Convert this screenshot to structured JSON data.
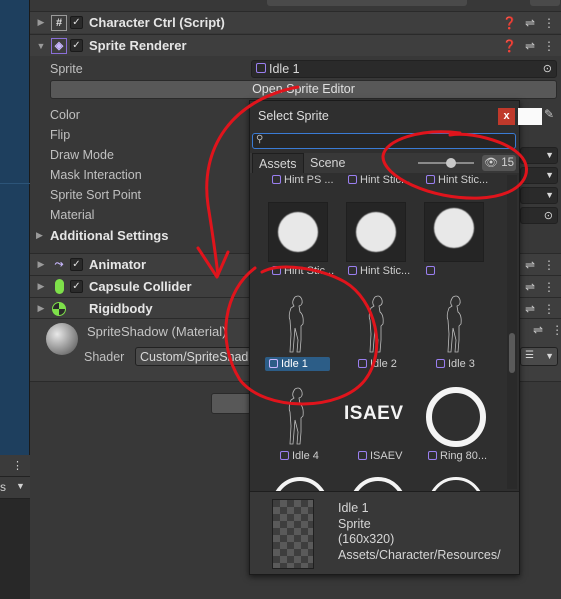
{
  "colors": {
    "accent_blue": "#2c5d87",
    "close_red": "#c0392b",
    "annotation_red": "#e0141c"
  },
  "components": {
    "character_ctrl": {
      "title": "Character Ctrl (Script)",
      "icon": "hash-script-icon"
    },
    "sprite_renderer": {
      "title": "Sprite Renderer",
      "icon": "sprite-renderer-icon"
    },
    "animator": {
      "title": "Animator",
      "icon": "animator-icon"
    },
    "capsule_collider": {
      "title": "Capsule Collider",
      "icon": "capsule-collider-icon"
    },
    "rigidbody": {
      "title": "Rigidbody",
      "icon": "rigidbody-icon"
    }
  },
  "sprite_renderer_props": {
    "sprite_label": "Sprite",
    "sprite_value": "Idle 1",
    "open_editor": "Open Sprite Editor",
    "color": "Color",
    "flip": "Flip",
    "draw_mode": "Draw Mode",
    "mask_interaction": "Mask Interaction",
    "sort_point": "Sprite Sort Point",
    "material": "Material",
    "additional": "Additional Settings"
  },
  "material": {
    "name": "SpriteShadow (Material)",
    "shader_label": "Shader",
    "shader_value": "Custom/SpriteShad"
  },
  "left_panel": {
    "dropdown_text": "s"
  },
  "popup": {
    "title": "Select Sprite",
    "close": "x",
    "search_placeholder": "",
    "tabs": [
      "Assets",
      "Scene"
    ],
    "hidden_count": "15",
    "top_row": [
      "Hint PS ...",
      "Hint Stic...",
      "Hint Stic..."
    ],
    "row1": [
      "Hint Stic...",
      "Hint Stic...",
      ""
    ],
    "row2": [
      "Idle 1",
      "Idle 2",
      "Idle 3"
    ],
    "row3": [
      "Idle 4",
      "ISAEV",
      "Ring 80..."
    ],
    "isaev_text": "ISAEV",
    "preview": {
      "name": "Idle 1",
      "type": "Sprite",
      "size": "(160x320)",
      "path": "Assets/Character/Resources/"
    }
  }
}
